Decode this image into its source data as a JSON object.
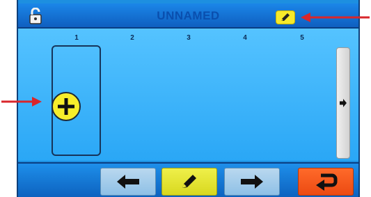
{
  "header": {
    "title": "UNNAMED"
  },
  "columns": [
    "1",
    "2",
    "3",
    "4",
    "5"
  ],
  "colors": {
    "screen_blue": "#1d8fe0",
    "content_blue": "#3bb4fb",
    "accent_yellow": "#f6ea2b",
    "return_orange": "#ff5a1f",
    "annotation_red": "#d9262b"
  },
  "icons": {
    "lock": "unlocked-padlock-icon",
    "edit": "pencil-icon",
    "add": "plus-icon",
    "next": "arrow-right-icon",
    "back": "arrow-left-icon",
    "forward": "arrow-right-icon",
    "return": "return-arrow-icon"
  }
}
